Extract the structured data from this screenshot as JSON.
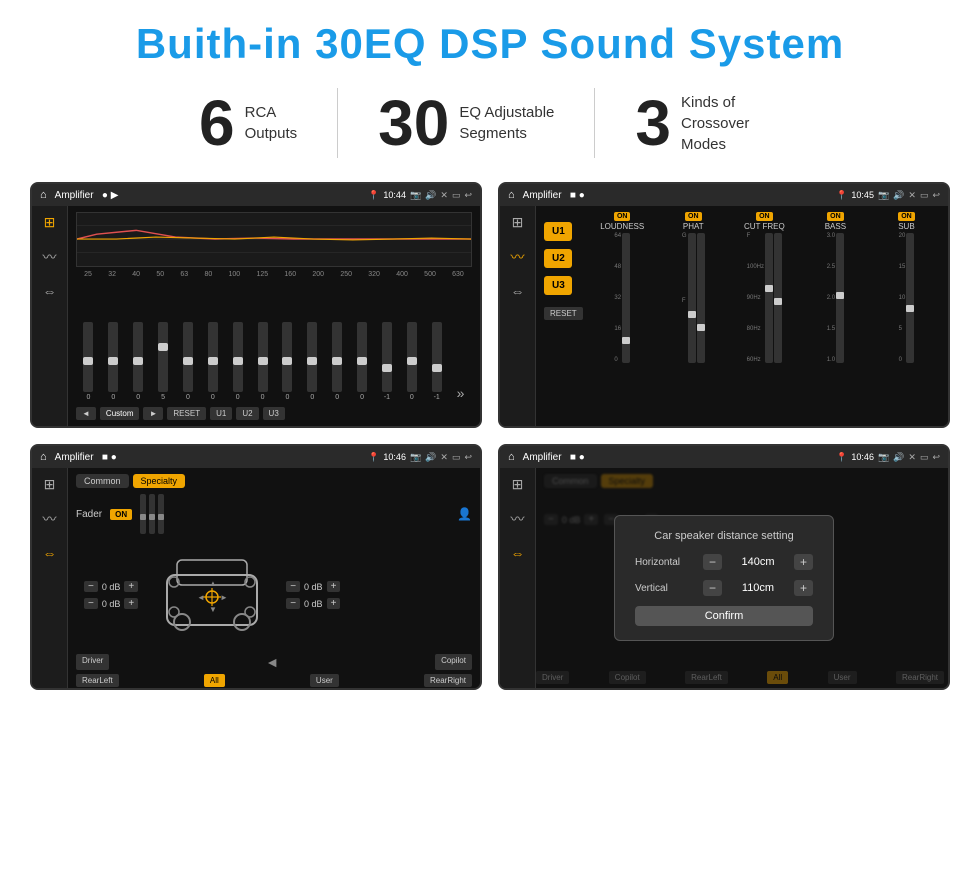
{
  "page": {
    "title": "Buith-in 30EQ DSP Sound System",
    "stats": [
      {
        "number": "6",
        "text_line1": "RCA",
        "text_line2": "Outputs"
      },
      {
        "number": "30",
        "text_line1": "EQ Adjustable",
        "text_line2": "Segments"
      },
      {
        "number": "3",
        "text_line1": "Kinds of",
        "text_line2": "Crossover Modes"
      }
    ]
  },
  "screens": {
    "screen1": {
      "topbar": {
        "title": "Amplifier",
        "time": "10:44"
      },
      "freqs": [
        "25",
        "32",
        "40",
        "50",
        "63",
        "80",
        "100",
        "125",
        "160",
        "200",
        "250",
        "320",
        "400",
        "500",
        "630"
      ],
      "values": [
        "0",
        "0",
        "0",
        "5",
        "0",
        "0",
        "0",
        "0",
        "0",
        "0",
        "0",
        "0",
        "-1",
        "0",
        "-1"
      ],
      "bottom_btns": [
        "◄",
        "Custom",
        "►",
        "RESET",
        "U1",
        "U2",
        "U3"
      ]
    },
    "screen2": {
      "topbar": {
        "title": "Amplifier",
        "time": "10:45"
      },
      "u_buttons": [
        "U1",
        "U2",
        "U3"
      ],
      "channels": [
        {
          "name": "LOUDNESS",
          "on": true
        },
        {
          "name": "PHAT",
          "on": true
        },
        {
          "name": "CUT FREQ",
          "on": true
        },
        {
          "name": "BASS",
          "on": true
        },
        {
          "name": "SUB",
          "on": true
        }
      ],
      "reset_label": "RESET"
    },
    "screen3": {
      "topbar": {
        "title": "Amplifier",
        "time": "10:46"
      },
      "tabs": [
        "Common",
        "Specialty"
      ],
      "fader_label": "Fader",
      "on_label": "ON",
      "db_controls": [
        {
          "value": "0 dB"
        },
        {
          "value": "0 dB"
        },
        {
          "value": "0 dB"
        },
        {
          "value": "0 dB"
        }
      ],
      "bottom_btns": [
        "Driver",
        "",
        "Copilot",
        "RearLeft",
        "All",
        "User",
        "RearRight"
      ]
    },
    "screen4": {
      "topbar": {
        "title": "Amplifier",
        "time": "10:46"
      },
      "tabs": [
        "Common",
        "Specialty"
      ],
      "dialog": {
        "title": "Car speaker distance setting",
        "horizontal_label": "Horizontal",
        "horizontal_value": "140cm",
        "vertical_label": "Vertical",
        "vertical_value": "110cm",
        "confirm_label": "Confirm"
      },
      "bottom_btns": [
        "Driver",
        "Copilot",
        "RearLeft",
        "All",
        "User",
        "RearRight"
      ]
    }
  },
  "icons": {
    "home": "⌂",
    "location": "📍",
    "volume": "🔊",
    "back": "↩",
    "settings": "⚙",
    "eq": "≡",
    "wave": "〰",
    "arrows": "⇔"
  }
}
